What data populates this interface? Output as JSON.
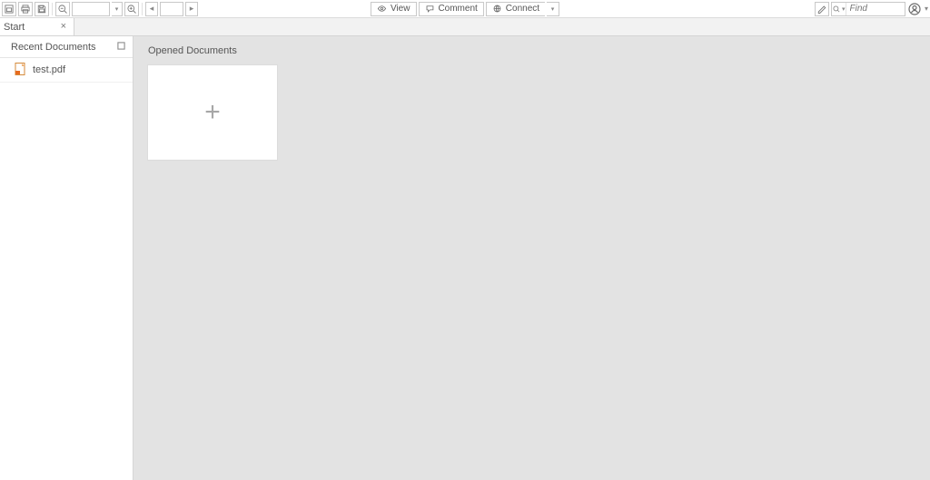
{
  "modes": {
    "view": "View",
    "comment": "Comment",
    "connect": "Connect"
  },
  "search": {
    "placeholder": "Find"
  },
  "tab": {
    "label": "Start"
  },
  "sidebar": {
    "header": "Recent Documents",
    "items": [
      {
        "name": "test.pdf"
      }
    ]
  },
  "content": {
    "title": "Opened Documents"
  }
}
